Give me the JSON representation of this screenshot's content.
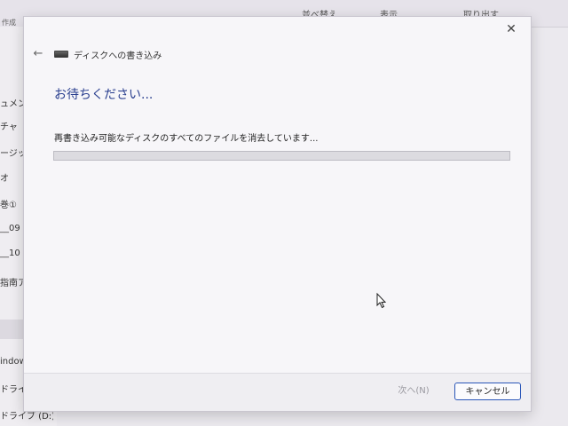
{
  "background": {
    "toolbar": {
      "sort_label": "並べ替え",
      "view_label": "表示",
      "extract_label": "取り出す"
    },
    "top_label": "作成",
    "sidebar": {
      "items": [
        {
          "label": "ュメント"
        },
        {
          "label": "チャ"
        },
        {
          "label": "ージック"
        },
        {
          "label": "オ"
        },
        {
          "label": "巻①"
        },
        {
          "label": "__09"
        },
        {
          "label": "__10"
        },
        {
          "label": "指南ア"
        },
        {
          "label": "indow"
        },
        {
          "label": "ドライ"
        },
        {
          "label": "ドライブ (D:)"
        }
      ]
    }
  },
  "dialog": {
    "header_title": "ディスクへの書き込み",
    "heading": "お待ちください...",
    "status": "再書き込み可能なディスクのすべてのファイルを消去しています...",
    "progress": 0,
    "buttons": {
      "next": "次へ(N)",
      "cancel": "キャンセル"
    },
    "close_icon": "close-icon",
    "back_icon": "back-arrow-icon",
    "drive_icon": "optical-drive-icon"
  },
  "colors": {
    "heading": "#2a3f8f",
    "cancel_border": "#2a56b8"
  }
}
